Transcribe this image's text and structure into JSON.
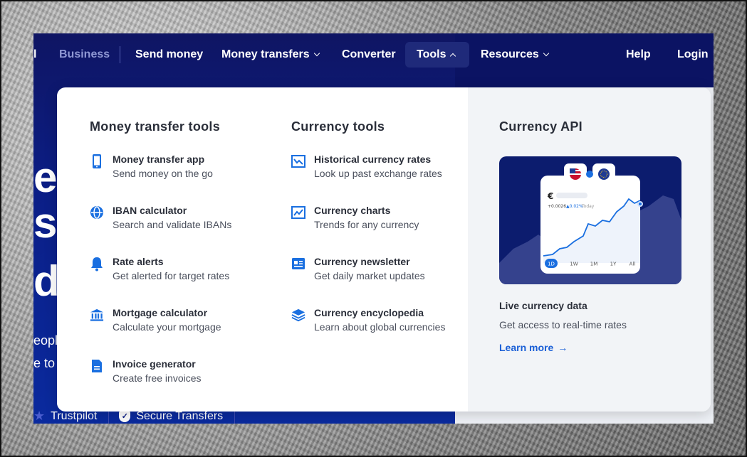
{
  "nav": {
    "partial_left": "l",
    "business": "Business",
    "send_money": "Send money",
    "money_transfers": "Money transfers",
    "converter": "Converter",
    "tools": "Tools",
    "resources": "Resources",
    "help": "Help",
    "login": "Login"
  },
  "hero": {
    "big_lines": [
      "e",
      "st",
      "d"
    ],
    "small_lines": [
      "eople",
      "e to"
    ],
    "trust_items": [
      "Trustpilot",
      "Secure Transfers"
    ]
  },
  "dropdown": {
    "money_transfer_tools": {
      "title": "Money transfer tools",
      "items": [
        {
          "title": "Money transfer app",
          "desc": "Send money on the go",
          "icon": "phone-icon"
        },
        {
          "title": "IBAN calculator",
          "desc": "Search and validate IBANs",
          "icon": "globe-icon"
        },
        {
          "title": "Rate alerts",
          "desc": "Get alerted for target rates",
          "icon": "bell-icon"
        },
        {
          "title": "Mortgage calculator",
          "desc": "Calculate your mortgage",
          "icon": "bank-icon"
        },
        {
          "title": "Invoice generator",
          "desc": "Create free invoices",
          "icon": "document-icon"
        }
      ]
    },
    "currency_tools": {
      "title": "Currency tools",
      "items": [
        {
          "title": "Historical currency rates",
          "desc": "Look up past exchange rates",
          "icon": "chart-down-icon"
        },
        {
          "title": "Currency charts",
          "desc": "Trends for any currency",
          "icon": "chart-line-icon"
        },
        {
          "title": "Currency newsletter",
          "desc": "Get daily market updates",
          "icon": "newspaper-icon"
        },
        {
          "title": "Currency encyclopedia",
          "desc": "Learn about global currencies",
          "icon": "layers-icon"
        }
      ]
    },
    "currency_api": {
      "title": "Currency API",
      "card": {
        "currency_symbol": "€",
        "change": "+0.0026",
        "change_pct": "▲0.02%",
        "period_label": "Today",
        "ranges": [
          "1D",
          "1W",
          "1M",
          "1Y",
          "All"
        ],
        "selected_range": "1D"
      },
      "label": "Live currency data",
      "desc": "Get access to real-time rates",
      "link": "Learn more"
    }
  },
  "colors": {
    "nav_bg": "#0b1363",
    "accent": "#1a5fd6",
    "dropdown_right_bg": "#f2f4f7"
  }
}
